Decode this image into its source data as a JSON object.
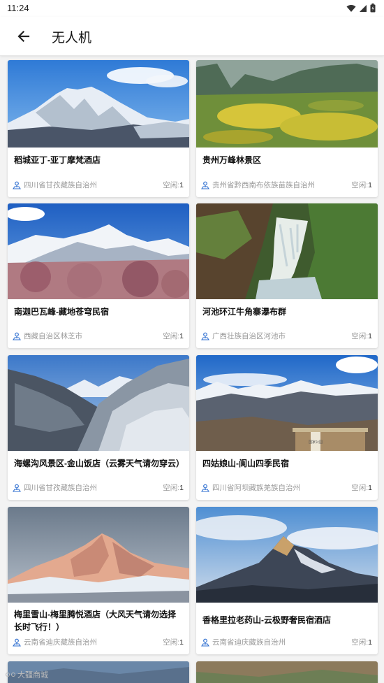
{
  "status_bar": {
    "time": "11:24"
  },
  "header": {
    "title": "无人机"
  },
  "cards": [
    {
      "title": "稻城亚丁-亚丁摩梵酒店",
      "location": "四川省甘孜藏族自治州",
      "status_label": "空闲:",
      "status_count": "1"
    },
    {
      "title": "贵州万峰林景区",
      "location": "贵州省黔西南布依族苗族自治州",
      "status_label": "空闲:",
      "status_count": "1"
    },
    {
      "title": "南迦巴瓦峰-藏地苍穹民宿",
      "location": "西藏自治区林芝市",
      "status_label": "空闲:",
      "status_count": "1"
    },
    {
      "title": "河池环江牛角寨瀑布群",
      "location": "广西壮族自治区河池市",
      "status_label": "空闲:",
      "status_count": "1"
    },
    {
      "title": "海螺沟风景区-金山饭店（云雾天气请勿穿云）",
      "location": "四川省甘孜藏族自治州",
      "status_label": "空闲:",
      "status_count": "1"
    },
    {
      "title": "四姑娘山-阆山四季民宿",
      "location": "四川省阿坝藏族羌族自治州",
      "status_label": "空闲:",
      "status_count": "1"
    },
    {
      "title": "梅里雪山-梅里腾悦酒店（大风天气请勿选择长时飞行！）",
      "location": "云南省迪庆藏族自治州",
      "status_label": "空闲:",
      "status_count": "1"
    },
    {
      "title": "香格里拉老药山-云极野奢民宿酒店",
      "location": "云南省迪庆藏族自治州",
      "status_label": "空闲:",
      "status_count": "1"
    }
  ],
  "sign_text": "国家公园",
  "watermark": "大疆商城"
}
